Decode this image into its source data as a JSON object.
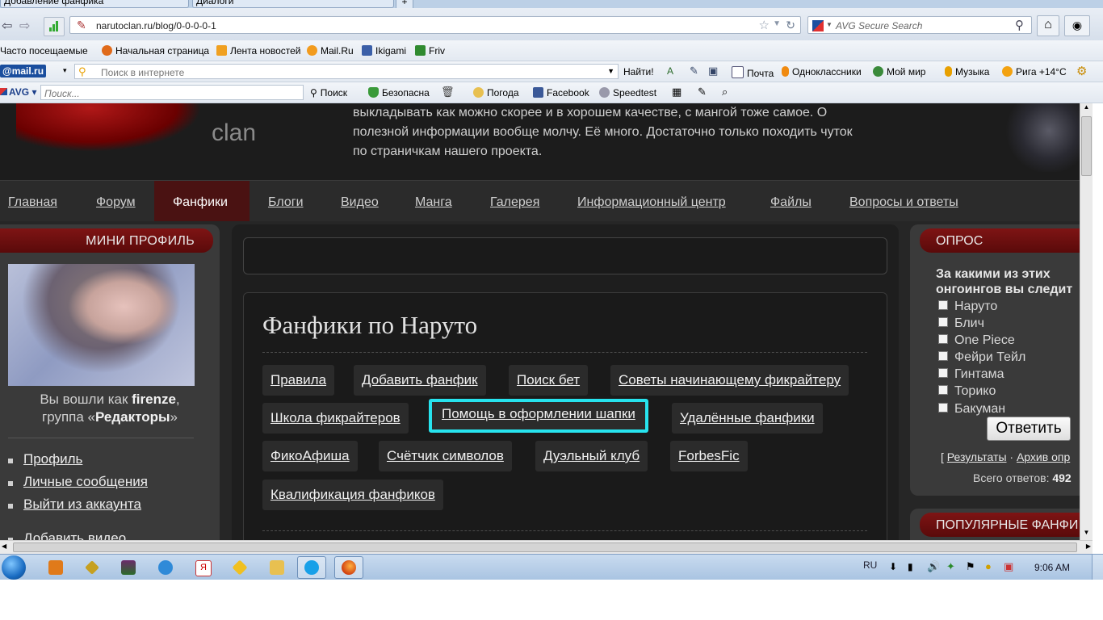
{
  "browser": {
    "tabs": [
      "Добавление фанфика",
      "Диалоги"
    ],
    "url": "narutoclan.ru/blog/0-0-0-0-1",
    "search_placeholder": "AVG Secure Search",
    "bookmarks": [
      "Часто посещаемые",
      "Начальная страница",
      "Лента новостей",
      "Mail.Ru",
      "Ikigami",
      "Friv"
    ],
    "mailru_toolbar": {
      "logo": "@mail.ru",
      "search_placeholder": "Поиск в интернете",
      "find_button": "Найти!",
      "items": [
        "Почта",
        "Одноклассники",
        "Мой мир",
        "Музыка",
        "Рига +14°C"
      ]
    },
    "avg_toolbar": {
      "logo": "AVG",
      "search_placeholder": "Поиск...",
      "search_button": "Поиск",
      "items": [
        "Безопасна",
        "Погода",
        "Facebook",
        "Speedtest"
      ]
    }
  },
  "site": {
    "logo_text": "clan",
    "intro_lines": [
      "выкладывать как можно скорее и в хорошем качестве, с мангой тоже самое. О",
      "полезной информации вообще молчу. Её много. Достаточно только походить чуток",
      "по страничкам нашего проекта."
    ],
    "nav": [
      "Главная",
      "Форум",
      "Фанфики",
      "Блоги",
      "Видео",
      "Манга",
      "Галерея",
      "Информационный центр",
      "Файлы",
      "Вопросы и ответы"
    ],
    "mini_profile": {
      "title": "МИНИ ПРОФИЛЬ",
      "logged_prefix": "Вы вошли как ",
      "username": "firenze",
      "group_prefix": "группа «",
      "group": "Редакторы",
      "group_suffix": "»",
      "comma": ",",
      "links": [
        "Профиль",
        "Личные сообщения",
        "Выйти из аккаунта",
        "Добавить видео"
      ]
    },
    "main": {
      "title": "Фанфики по Наруто",
      "buttons": [
        "Правила",
        "Добавить фанфик",
        "Поиск бет",
        "Советы начинающему фикрайтеру",
        "Школа фикрайтеров",
        "Помощь в оформлении шапки",
        "Удалённые фанфики",
        "ФикоАфиша",
        "Счётчик символов",
        "Дуэльный клуб",
        "ForbesFic",
        "Квалификация фанфиков"
      ]
    },
    "poll": {
      "title": "ОПРОС",
      "question": [
        "За какими из этих",
        "онгоингов вы следит"
      ],
      "options": [
        "Наруто",
        "Блич",
        "One Piece",
        "Фейри Тейл",
        "Гинтама",
        "Торико",
        "Бакуман"
      ],
      "answer_button": "Ответить",
      "results_link": "Результаты",
      "archive_link": "Архив опр",
      "total_label": "Всего ответов: ",
      "total_value": "492"
    },
    "popular": {
      "title": "ПОПУЛЯРНЫЕ ФАНФИ"
    }
  },
  "taskbar": {
    "lang": "RU",
    "time": "9:06 AM"
  },
  "colors": {
    "highlight": "#27e3ee",
    "accent_red": "#7e1414",
    "page_bg": "#262626"
  }
}
